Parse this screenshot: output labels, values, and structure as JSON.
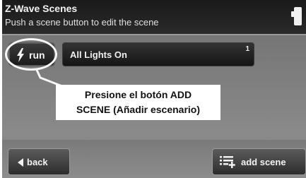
{
  "header": {
    "title": "Z-Wave Scenes",
    "subtitle": "Push a scene button to edit the scene"
  },
  "scene_row": {
    "run_label": "run",
    "run_icon": "lightning-bolt-icon",
    "scene_name": "All Lights On",
    "scene_number": "1"
  },
  "callout": {
    "line1": "Presione el botón ADD",
    "line2": "SCENE (Añadir escenario)"
  },
  "bottom_bar": {
    "back_label": "back",
    "back_icon": "left-arrow-icon",
    "add_label": "add scene",
    "add_icon": "add-list-icon"
  },
  "colors": {
    "header_bg": "#1a1a1a",
    "screen_bg": "#7d7d7d",
    "button_bg": "#1c1c1c",
    "callout_bg": "#ffffff"
  }
}
